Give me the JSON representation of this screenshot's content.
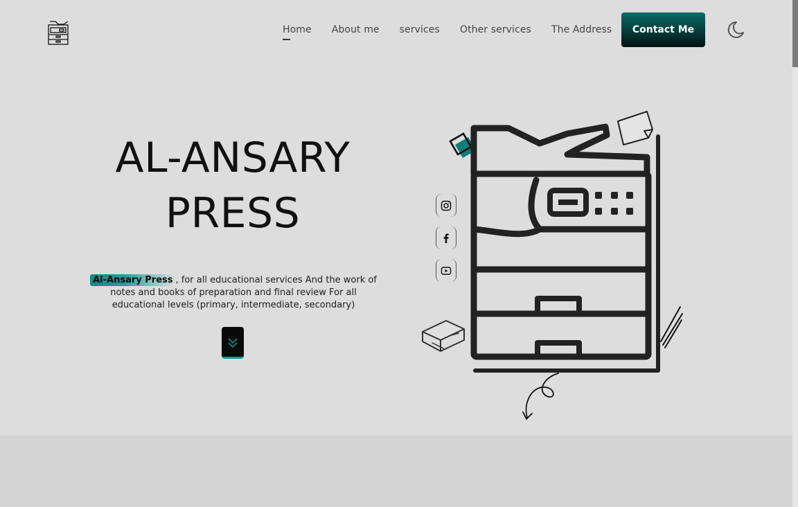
{
  "header": {
    "logo_icon": "printer-icon",
    "nav": [
      {
        "label": "Home",
        "active": true
      },
      {
        "label": "About me"
      },
      {
        "label": "services"
      },
      {
        "label": "Other services"
      },
      {
        "label": "The Address"
      }
    ],
    "contact_label": "Contact Me",
    "theme_icon": "moon-icon"
  },
  "hero": {
    "title_line1": "AL-ANSARY",
    "title_line2": "PRESS",
    "brand": "Al-Ansary Press",
    "description": ", for all educational services And the work of notes and books of preparation and final review For all educational levels (primary, intermediate, secondary)",
    "scroll_icon": "chevrons-down-icon"
  },
  "social": [
    {
      "icon": "instagram-icon"
    },
    {
      "icon": "facebook-icon"
    },
    {
      "icon": "youtube-icon"
    }
  ],
  "colors": {
    "accent": "#0b6b67",
    "accent_light": "#1a9a93",
    "background": "#dddddd",
    "band": "#d4d4d4"
  }
}
